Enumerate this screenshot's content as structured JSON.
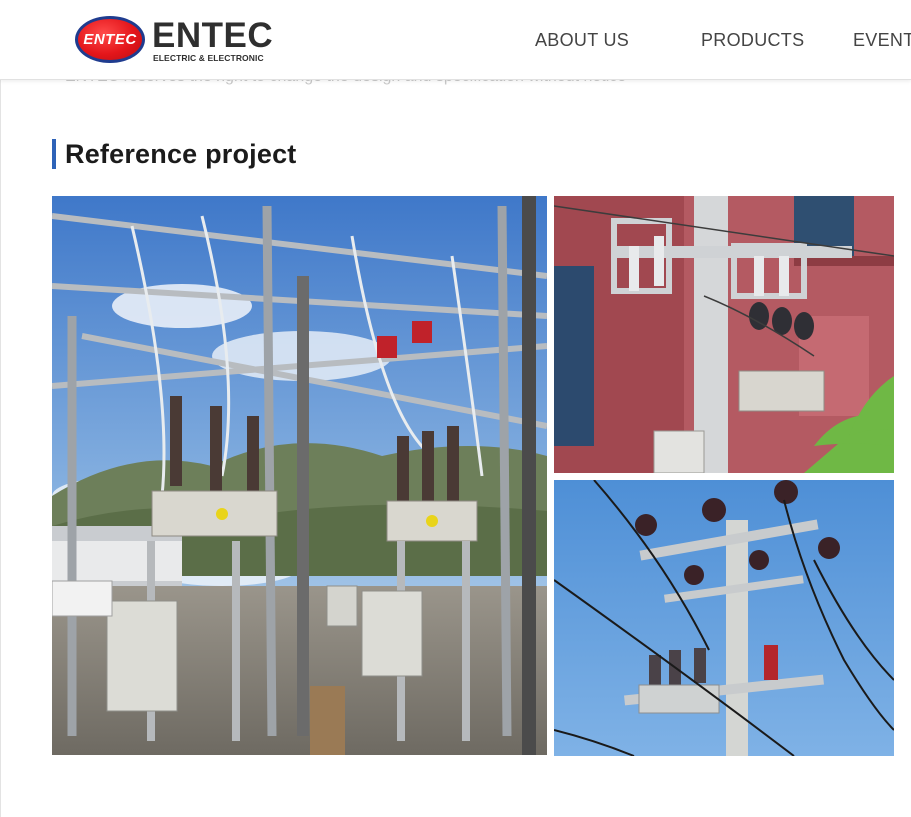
{
  "header": {
    "logo": {
      "badge_text": "ENTEC",
      "wordmark": "ENTEC",
      "subtitle": "ELECTRIC & ELECTRONIC"
    },
    "nav": [
      {
        "label": "ABOUT US"
      },
      {
        "label": "PRODUCTS"
      },
      {
        "label": "EVENT"
      }
    ]
  },
  "notice": "ENTEC reserves the right to change the design and specification without notice",
  "section": {
    "title": "Reference project",
    "accent_color": "#2e63b8"
  },
  "gallery": [
    {
      "icon": "substation-photo"
    },
    {
      "icon": "pole-mounted-recloser-photo"
    },
    {
      "icon": "overhead-line-switch-photo"
    }
  ],
  "colors": {
    "logo_red": "#e4161b",
    "logo_blue": "#1f3c8f",
    "text_dark": "#1b1b1b",
    "nav_text": "#444444"
  }
}
